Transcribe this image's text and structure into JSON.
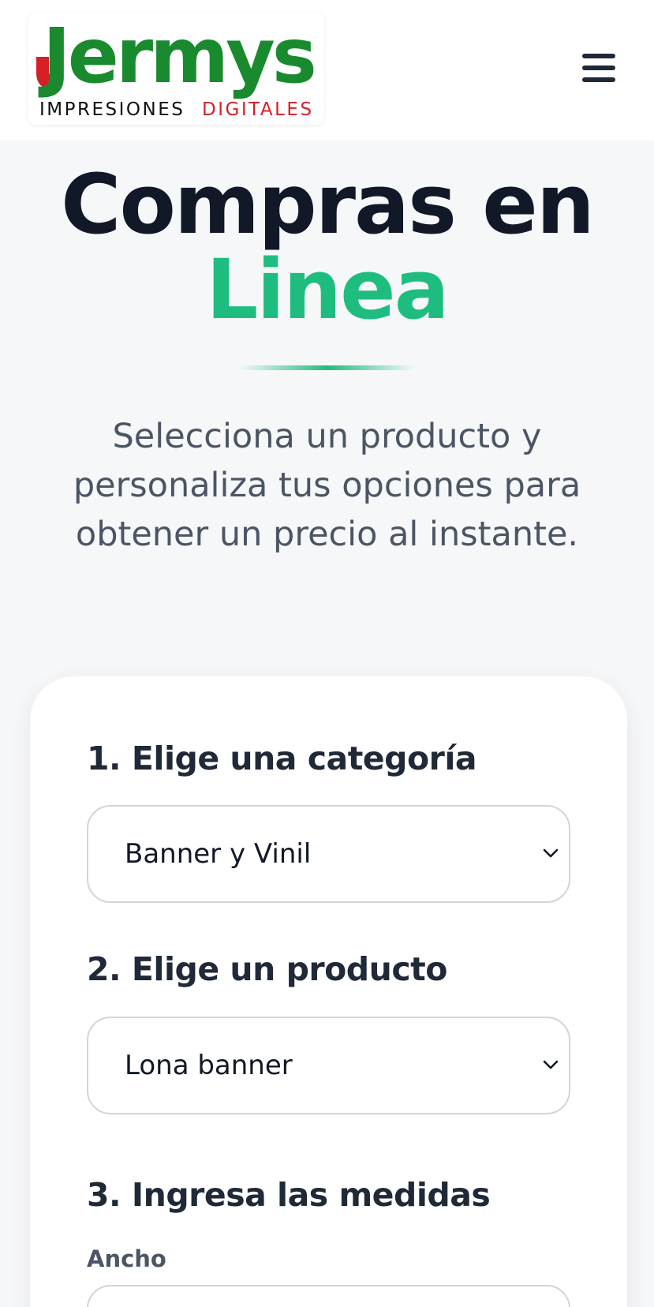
{
  "header": {
    "logo": {
      "brand": "Jermys",
      "tagline_1": "IMPRESIONES",
      "tagline_2": "DIGITALES",
      "brand_color": "#1a8a2e",
      "accent_color": "#d71f27"
    },
    "menu_icon": "hamburger-menu-icon"
  },
  "hero": {
    "title_line1": "Compras en",
    "title_line2": "Linea",
    "subtitle": "Selecciona un producto y personaliza tus opciones para obtener un precio al instante.",
    "accent_color": "#1ebd7f"
  },
  "form": {
    "step1": {
      "title": "1. Elige una categoría",
      "selected": "Banner y Vinil"
    },
    "step2": {
      "title": "2. Elige un producto",
      "selected": "Lona banner"
    },
    "step3": {
      "title": "3. Ingresa las medidas",
      "width_label": "Ancho",
      "width_value": ""
    }
  }
}
